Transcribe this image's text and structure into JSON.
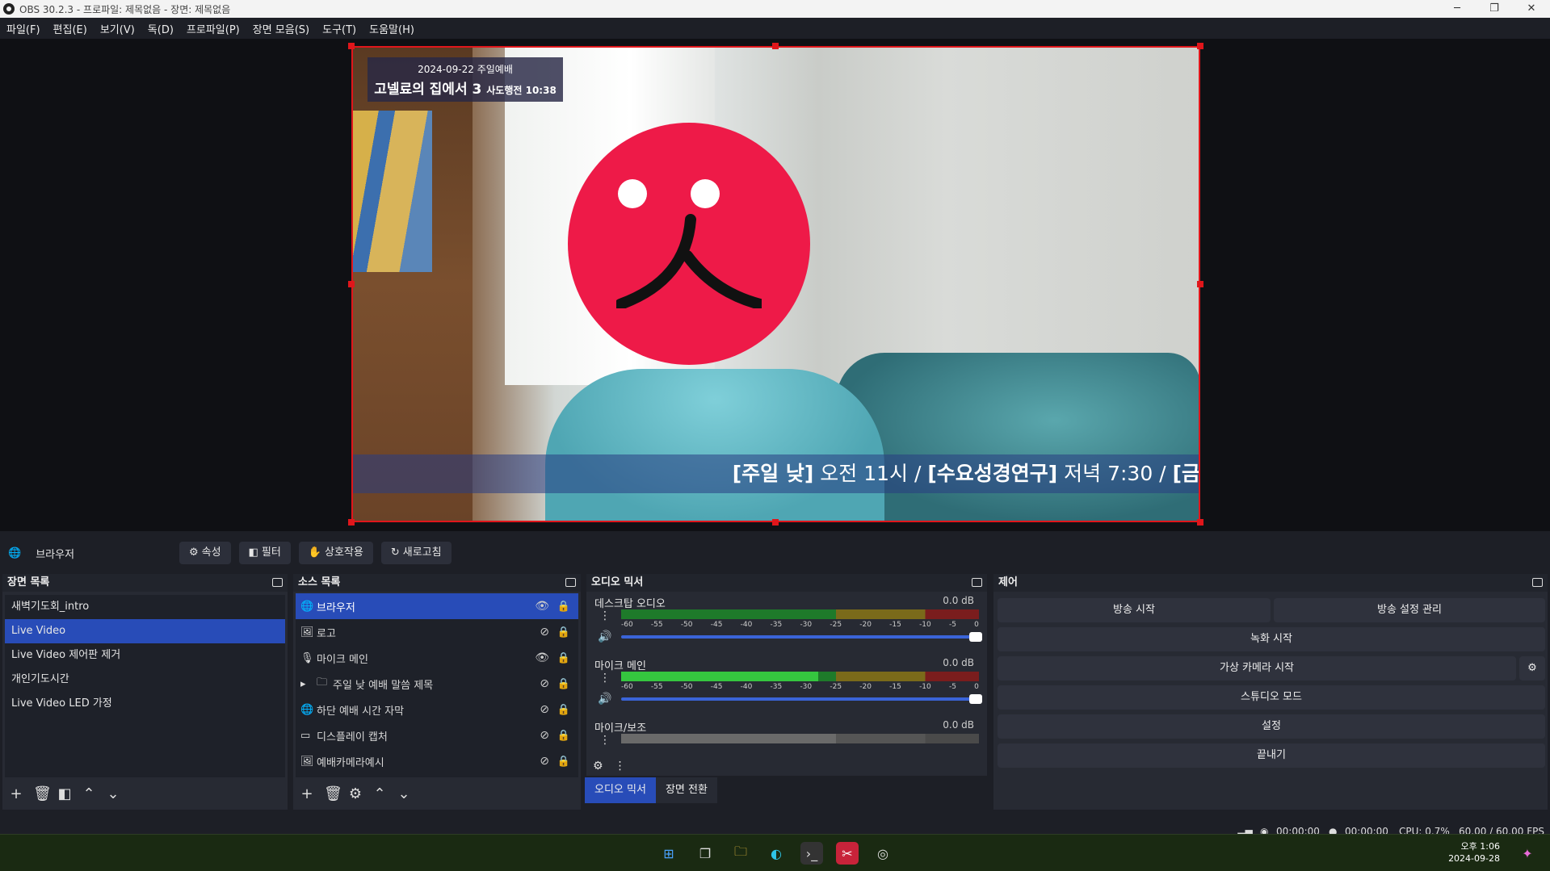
{
  "window": {
    "title": "OBS 30.2.3 - 프로파일: 제목없음 - 장면: 제목없음",
    "minimize": "─",
    "maximize": "❐",
    "close": "✕"
  },
  "menu": [
    "파일(F)",
    "편집(E)",
    "보기(V)",
    "독(D)",
    "프로파일(P)",
    "장면 모음(S)",
    "도구(T)",
    "도움말(H)"
  ],
  "preview": {
    "overlay_date": "2024-09-22 주일예배",
    "overlay_title": "고넬료의 집에서 3",
    "overlay_sub": "사도행전 10:38",
    "ticker_b1": "[주일 낮]",
    "ticker_t1": " 오전 11시 / ",
    "ticker_b2": "[수요성경연구]",
    "ticker_t2": " 저녁 7:30 / ",
    "ticker_b3": "[금"
  },
  "source_toolbar": {
    "current": "브라우저",
    "properties": "속성",
    "filters": "필터",
    "interact": "상호작용",
    "refresh": "새로고침"
  },
  "scenes": {
    "title": "장면 목록",
    "items": [
      "새벽기도회_intro",
      "Live Video",
      "Live Video 제어판 제거",
      "개인기도시간",
      "Live Video LED 가정"
    ],
    "selected": 1
  },
  "sources": {
    "title": "소스 목록",
    "items": [
      {
        "name": "브라우저",
        "icon": "globe",
        "visible": true
      },
      {
        "name": "로고",
        "icon": "image",
        "visible": false
      },
      {
        "name": "마이크 메인",
        "icon": "mic",
        "visible": true
      },
      {
        "name": "주일 낮 예배 말씀 제목",
        "icon": "folder",
        "visible": false
      },
      {
        "name": "하단 예배 시간 자막",
        "icon": "globe",
        "visible": false
      },
      {
        "name": "디스플레이 캡처",
        "icon": "monitor",
        "visible": false
      },
      {
        "name": "예배카메라예시",
        "icon": "image",
        "visible": false
      }
    ],
    "selected": 0
  },
  "mixer": {
    "title": "오디오 믹서",
    "channels": [
      {
        "name": "데스크탑 오디오",
        "db": "0.0 dB",
        "level": 0
      },
      {
        "name": "마이크 메인",
        "db": "0.0 dB",
        "level": 0.55
      },
      {
        "name": "마이크/보조",
        "db": "0.0 dB",
        "level": 0
      }
    ],
    "scale": [
      "-60",
      "-55",
      "-50",
      "-45",
      "-40",
      "-35",
      "-30",
      "-25",
      "-20",
      "-15",
      "-10",
      "-5",
      "0"
    ]
  },
  "tabs": {
    "mixer": "오디오 믹서",
    "transitions": "장면 전환"
  },
  "controls": {
    "title": "제어",
    "start_stream": "방송 시작",
    "stream_settings": "방송 설정 관리",
    "start_record": "녹화 시작",
    "virtual_cam": "가상 카메라 시작",
    "studio": "스튜디오 모드",
    "settings": "설정",
    "exit": "끝내기"
  },
  "status": {
    "stream_time": "00:00:00",
    "record_time": "00:00:00",
    "cpu": "CPU: 0.7%",
    "fps": "60.00 / 60.00 FPS"
  },
  "clock": {
    "time": "오후 1:06",
    "date": "2024-09-28"
  }
}
